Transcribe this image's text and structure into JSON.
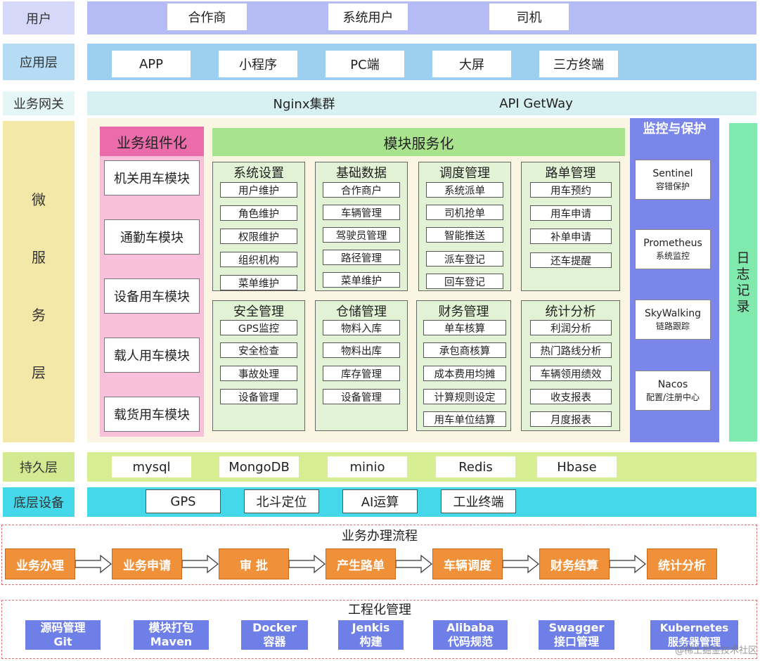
{
  "layers": {
    "user": {
      "label": "用户",
      "items": [
        "合作商",
        "系统用户",
        "司机"
      ]
    },
    "app": {
      "label": "应用层",
      "items": [
        "APP",
        "小程序",
        "PC端",
        "大屏",
        "三方终端"
      ]
    },
    "gateway": {
      "label": "业务网关",
      "items": [
        "Nginx集群",
        "API GetWay"
      ]
    },
    "micro": {
      "label_chars": [
        "微",
        "服",
        "务",
        "层"
      ]
    },
    "persist": {
      "label": "持久层",
      "items": [
        "mysql",
        "MongoDB",
        "minio",
        "Redis",
        "Hbase"
      ]
    },
    "device": {
      "label": "底层设备",
      "items": [
        "GPS",
        "北斗定位",
        "AI运算",
        "工业终端"
      ]
    }
  },
  "components": {
    "title": "业务组件化",
    "items": [
      "机关用车模块",
      "通勤车模块",
      "设备用车模块",
      "载人用车模块",
      "载货用车模块"
    ]
  },
  "modules": {
    "title": "模块服务化",
    "groups": [
      {
        "title": "系统设置",
        "items": [
          "用户维护",
          "角色维护",
          "权限维护",
          "组织机构",
          "菜单维护"
        ]
      },
      {
        "title": "基础数据",
        "items": [
          "合作商户",
          "车辆管理",
          "驾驶员管理",
          "路径管理",
          "菜单维护"
        ]
      },
      {
        "title": "调度管理",
        "items": [
          "系统派单",
          "司机抢单",
          "智能推送",
          "派车登记",
          "回车登记"
        ]
      },
      {
        "title": "路单管理",
        "items": [
          "用车预约",
          "用车申请",
          "补单申请",
          "还车提醒"
        ]
      },
      {
        "title": "安全管理",
        "items": [
          "GPS监控",
          "安全检查",
          "事故处理",
          "设备管理"
        ]
      },
      {
        "title": "仓储管理",
        "items": [
          "物料入库",
          "物料出库",
          "库存管理",
          "设备管理"
        ]
      },
      {
        "title": "财务管理",
        "items": [
          "单车核算",
          "承包商核算",
          "成本费用均摊",
          "计算规则设定",
          "用车单位结算"
        ]
      },
      {
        "title": "统计分析",
        "items": [
          "利润分析",
          "热门路线分析",
          "车辆领用绩效",
          "收支报表",
          "月度报表"
        ]
      }
    ]
  },
  "monitor": {
    "title": "监控与保护",
    "items": [
      {
        "name": "Sentinel",
        "desc": "容错保护"
      },
      {
        "name": "Prometheus",
        "desc": "系统监控"
      },
      {
        "name": "SkyWalking",
        "desc": "链路跟踪"
      },
      {
        "name": "Nacos",
        "desc": "配置/注册中心"
      }
    ]
  },
  "log": {
    "chars": [
      "日",
      "志",
      "记",
      "录"
    ]
  },
  "flow": {
    "title": "业务办理流程",
    "steps": [
      "业务办理",
      "业务申请",
      "审  批",
      "产生路单",
      "车辆调度",
      "财务结算",
      "统计分析"
    ]
  },
  "engineering": {
    "title": "工程化管理",
    "items": [
      {
        "l1": "源码管理",
        "l2": "Git"
      },
      {
        "l1": "模块打包",
        "l2": "Maven"
      },
      {
        "l1": "Docker",
        "l2": "容器"
      },
      {
        "l1": "Jenkis",
        "l2": "构建"
      },
      {
        "l1": "Alibaba",
        "l2": "代码规范"
      },
      {
        "l1": "Swagger",
        "l2": "接口管理"
      },
      {
        "l1": "Kubernetes",
        "l2": "服务器管理"
      }
    ]
  },
  "watermark": "@稀土掘金技术社区",
  "colors": {
    "user": "#b4bbf5",
    "app": "#9ccff0",
    "gateway": "#d7f1f3",
    "micro": "#f4e8a8",
    "component_bg": "#f8c0da",
    "component_title": "#ea6cab",
    "module_title": "#a9e38e",
    "monitor": "#7b86ea",
    "log": "#7fe9ae",
    "persist": "#d8ee92",
    "device": "#44d8ea",
    "flow": "#f0913a",
    "engineering": "#6f7fe8"
  }
}
